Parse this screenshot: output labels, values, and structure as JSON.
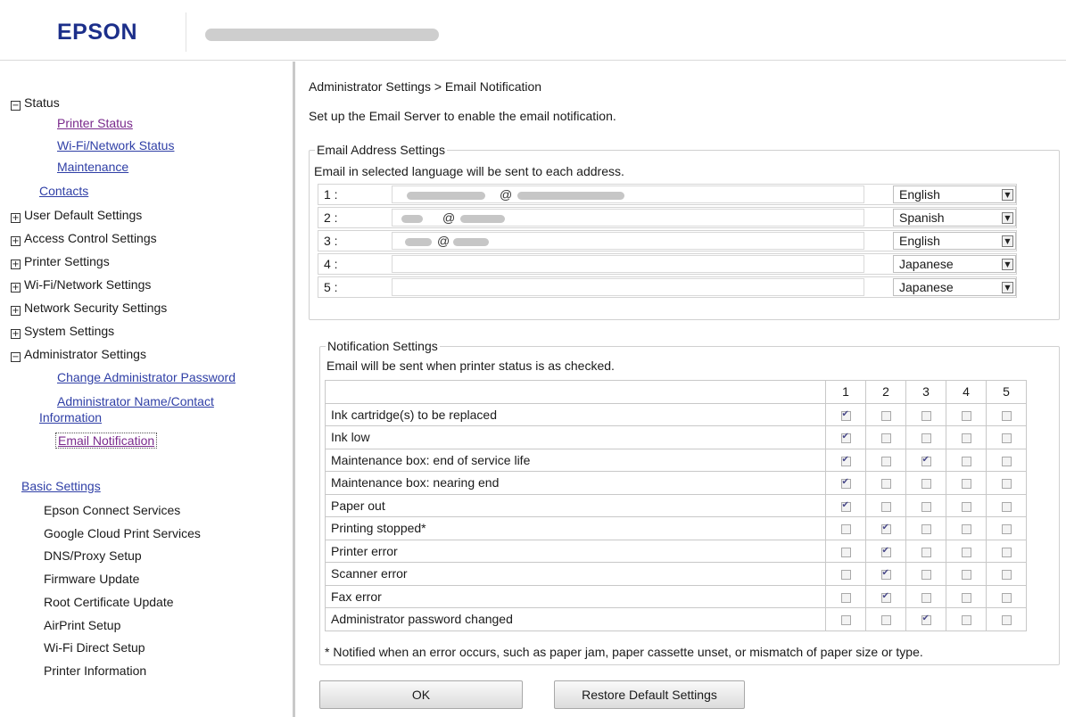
{
  "header": {
    "logo": "EPSON"
  },
  "sidebar": {
    "status": "Status",
    "printer_status": "Printer Status",
    "wifi_status": "Wi-Fi/Network Status",
    "maintenance": "Maintenance",
    "contacts": "Contacts",
    "user_default": "User Default Settings",
    "access_control": "Access Control Settings",
    "printer_settings": "Printer Settings",
    "wifi_network": "Wi-Fi/Network Settings",
    "network_security": "Network Security Settings",
    "system_settings": "System Settings",
    "admin_settings": "Administrator Settings",
    "change_admin_pw": "Change Administrator Password",
    "admin_name_1": "Administrator Name/Contact",
    "admin_name_2": "Information",
    "email_notification": "Email Notification",
    "basic_settings": "Basic Settings",
    "basic_items": [
      "Epson Connect Services",
      "Google Cloud Print Services",
      "DNS/Proxy Setup",
      "Firmware Update",
      "Root Certificate Update",
      "AirPrint Setup",
      "Wi-Fi Direct Setup",
      "Printer Information"
    ],
    "toggle_collapse": "−",
    "toggle_expand": "+"
  },
  "main": {
    "breadcrumb": "Administrator Settings > Email Notification",
    "intro": "Set up the Email Server to enable the email notification.",
    "email_group": {
      "legend": "Email Address Settings",
      "desc": "Email in selected language will be sent to each address.",
      "rows": [
        {
          "index": "1 :",
          "at": "@",
          "language": "English"
        },
        {
          "index": "2 :",
          "at": "@",
          "language": "Spanish"
        },
        {
          "index": "3 :",
          "at": "@",
          "language": "English"
        },
        {
          "index": "4 :",
          "at": "",
          "language": "Japanese"
        },
        {
          "index": "5 :",
          "at": "",
          "language": "Japanese"
        }
      ],
      "dropdown_arrow": "▼"
    },
    "notif_group": {
      "legend": "Notification Settings",
      "desc": "Email will be sent when printer status is as checked.",
      "columns": [
        "1",
        "2",
        "3",
        "4",
        "5"
      ],
      "rows": [
        {
          "label": "Ink cartridge(s) to be replaced",
          "checks": [
            true,
            false,
            false,
            false,
            false
          ]
        },
        {
          "label": "Ink low",
          "checks": [
            true,
            false,
            false,
            false,
            false
          ]
        },
        {
          "label": "Maintenance box: end of service life",
          "checks": [
            true,
            false,
            true,
            false,
            false
          ]
        },
        {
          "label": "Maintenance box: nearing end",
          "checks": [
            true,
            false,
            false,
            false,
            false
          ]
        },
        {
          "label": "Paper out",
          "checks": [
            true,
            false,
            false,
            false,
            false
          ]
        },
        {
          "label": "Printing stopped*",
          "checks": [
            false,
            true,
            false,
            false,
            false
          ]
        },
        {
          "label": "Printer error",
          "checks": [
            false,
            true,
            false,
            false,
            false
          ]
        },
        {
          "label": "Scanner error",
          "checks": [
            false,
            true,
            false,
            false,
            false
          ]
        },
        {
          "label": "Fax error",
          "checks": [
            false,
            true,
            false,
            false,
            false
          ]
        },
        {
          "label": "Administrator password changed",
          "checks": [
            false,
            false,
            true,
            false,
            false
          ]
        }
      ],
      "footnote": "* Notified when an error occurs, such as paper jam, paper cassette unset, or mismatch of paper size or type."
    },
    "buttons": {
      "ok": "OK",
      "restore": "Restore Default Settings"
    }
  }
}
